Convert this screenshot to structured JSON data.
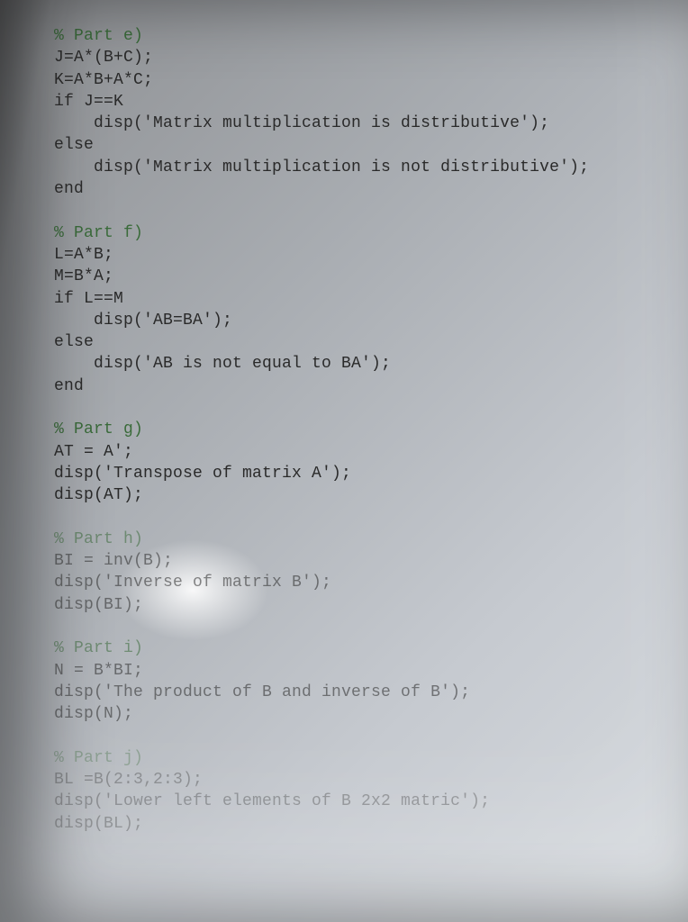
{
  "code": {
    "lines": [
      {
        "t": "% Part e)",
        "cls": "comment"
      },
      {
        "t": "J=A*(B+C);",
        "cls": ""
      },
      {
        "t": "K=A*B+A*C;",
        "cls": ""
      },
      {
        "t": "if J==K",
        "cls": ""
      },
      {
        "t": "    disp('Matrix multiplication is distributive');",
        "cls": ""
      },
      {
        "t": "else",
        "cls": ""
      },
      {
        "t": "    disp('Matrix multiplication is not distributive');",
        "cls": ""
      },
      {
        "t": "end",
        "cls": ""
      },
      {
        "t": "",
        "cls": ""
      },
      {
        "t": "% Part f)",
        "cls": "comment"
      },
      {
        "t": "L=A*B;",
        "cls": ""
      },
      {
        "t": "M=B*A;",
        "cls": ""
      },
      {
        "t": "if L==M",
        "cls": ""
      },
      {
        "t": "    disp('AB=BA');",
        "cls": ""
      },
      {
        "t": "else",
        "cls": ""
      },
      {
        "t": "    disp('AB is not equal to BA');",
        "cls": ""
      },
      {
        "t": "end",
        "cls": ""
      },
      {
        "t": "",
        "cls": ""
      },
      {
        "t": "% Part g)",
        "cls": "comment"
      },
      {
        "t": "AT = A';",
        "cls": ""
      },
      {
        "t": "disp('Transpose of matrix A');",
        "cls": ""
      },
      {
        "t": "disp(AT);",
        "cls": ""
      },
      {
        "t": "",
        "cls": ""
      },
      {
        "t": "% Part h)",
        "cls": "comment faded"
      },
      {
        "t": "BI = inv(B);",
        "cls": "faded"
      },
      {
        "t": "disp('Inverse of matrix B');",
        "cls": "faded"
      },
      {
        "t": "disp(BI);",
        "cls": "faded"
      },
      {
        "t": "",
        "cls": ""
      },
      {
        "t": "% Part i)",
        "cls": "comment faded"
      },
      {
        "t": "N = B*BI;",
        "cls": "faded"
      },
      {
        "t": "disp('The product of B and inverse of B');",
        "cls": "faded"
      },
      {
        "t": "disp(N);",
        "cls": "faded"
      },
      {
        "t": "",
        "cls": ""
      },
      {
        "t": "% Part j)",
        "cls": "comment faded2"
      },
      {
        "t": "BL =B(2:3,2:3);",
        "cls": "faded2"
      },
      {
        "t": "disp('Lower left elements of B 2x2 matric');",
        "cls": "faded2"
      },
      {
        "t": "disp(BL);",
        "cls": "faded2"
      }
    ]
  }
}
